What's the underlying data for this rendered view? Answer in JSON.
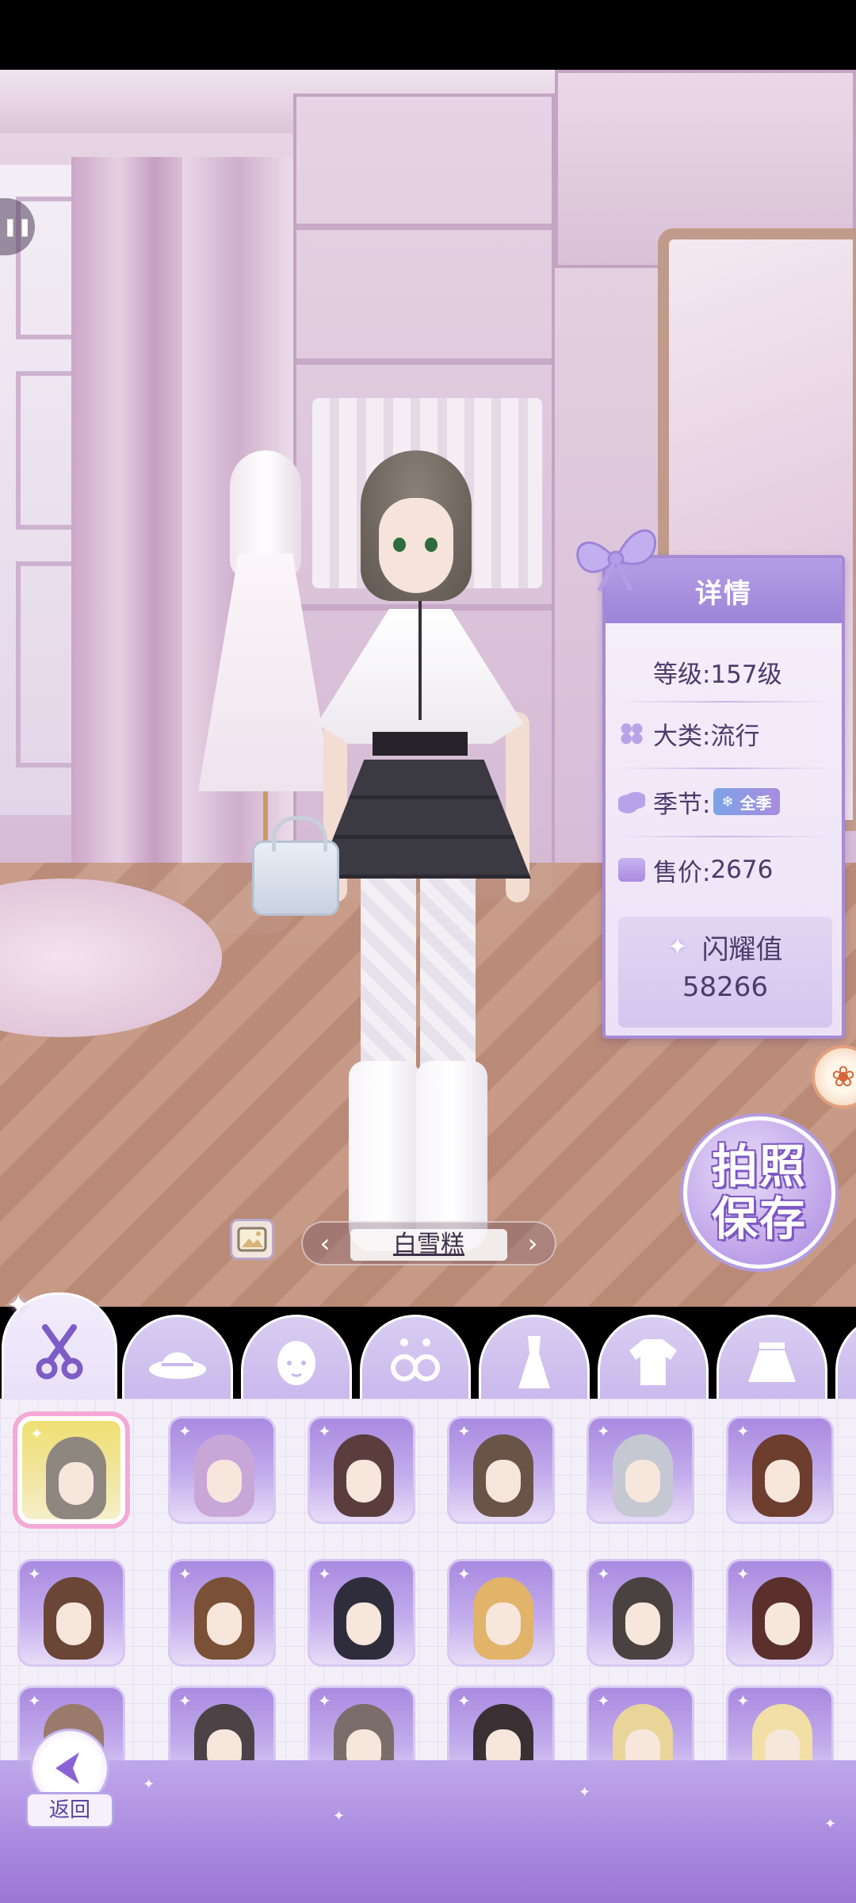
{
  "details": {
    "title": "详情",
    "level_label": "等级:",
    "level_value": "157级",
    "category_label": "大类:",
    "category_value": "流行",
    "season_label": "季节:",
    "season_value": "全季",
    "price_label": "售价:",
    "price_value": "2676",
    "shine_label": "闪耀值",
    "shine_value": "58266"
  },
  "photo_save": {
    "line1": "拍照",
    "line2": "保存"
  },
  "outfit_selector": {
    "name": "白雪糕",
    "prev": "‹",
    "next": "›"
  },
  "tabs": [
    {
      "name": "hair",
      "icon": "scissors-icon",
      "active": true
    },
    {
      "name": "hat",
      "icon": "hat-icon"
    },
    {
      "name": "face",
      "icon": "face-icon"
    },
    {
      "name": "earrings",
      "icon": "earrings-icon"
    },
    {
      "name": "dress",
      "icon": "dress-icon"
    },
    {
      "name": "top",
      "icon": "shirt-icon"
    },
    {
      "name": "skirt",
      "icon": "skirt-icon"
    },
    {
      "name": "more",
      "icon": "more-tab-icon"
    }
  ],
  "items": [
    {
      "hair": "#8e877f",
      "selected": true
    },
    {
      "hair": "#c9a6d8"
    },
    {
      "hair": "#5a3d3c"
    },
    {
      "hair": "#6a5448"
    },
    {
      "hair": "#c5c8d3"
    },
    {
      "hair": "#6d3d2e"
    },
    {
      "hair": "#6b4536"
    },
    {
      "hair": "#7a5137"
    },
    {
      "hair": "#2f2d3c"
    },
    {
      "hair": "#e1b46a"
    },
    {
      "hair": "#4a4240"
    },
    {
      "hair": "#5a2f2c"
    },
    {
      "hair": "#9a7a6a"
    },
    {
      "hair": "#4d4346"
    },
    {
      "hair": "#7b6e6a"
    },
    {
      "hair": "#3a3034"
    },
    {
      "hair": "#e9d59a"
    },
    {
      "hair": "#f1dfa6"
    }
  ],
  "back": {
    "label": "返回"
  },
  "colors": {
    "accent": "#a68bd3",
    "panel_header": "#9d84d8",
    "selected_border": "#f4a9d7"
  }
}
